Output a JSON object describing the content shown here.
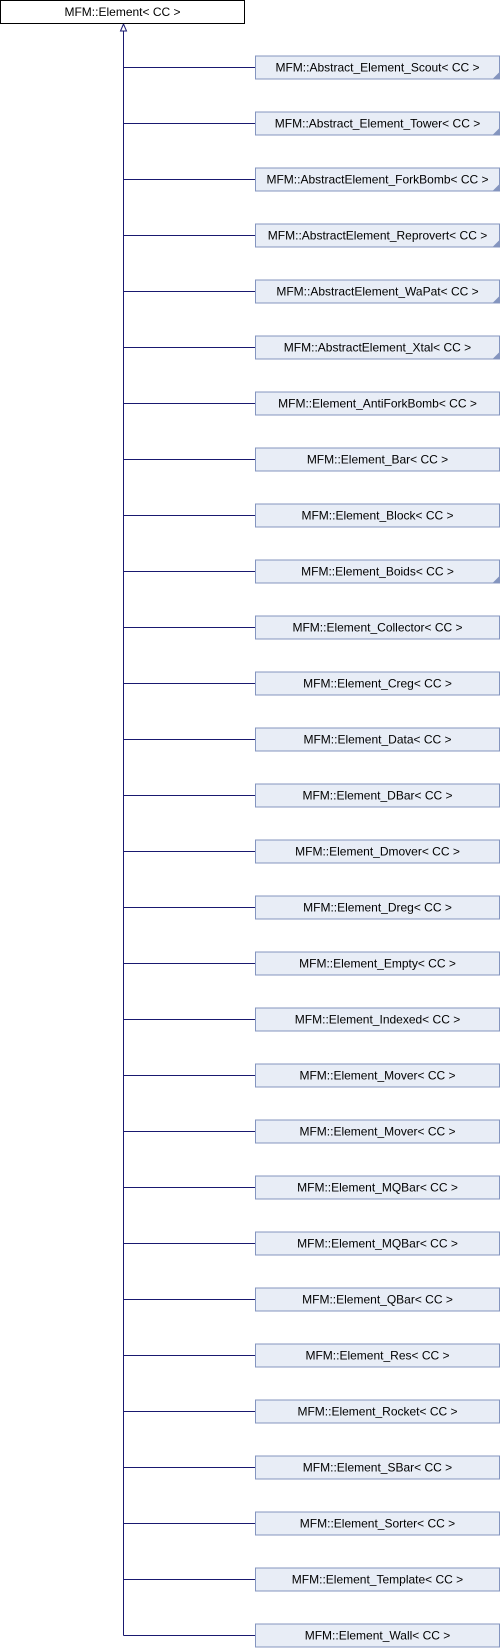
{
  "diagram": {
    "type": "inheritance-diagram",
    "base": {
      "label": "MFM::Element< CC >"
    },
    "derived": [
      {
        "label": "MFM::Abstract_Element_Scout< CC >",
        "has_more": true
      },
      {
        "label": "MFM::Abstract_Element_Tower< CC >",
        "has_more": true
      },
      {
        "label": "MFM::AbstractElement_ForkBomb< CC >",
        "has_more": true
      },
      {
        "label": "MFM::AbstractElement_Reprovert< CC >",
        "has_more": true
      },
      {
        "label": "MFM::AbstractElement_WaPat< CC >",
        "has_more": true
      },
      {
        "label": "MFM::AbstractElement_Xtal< CC >",
        "has_more": true
      },
      {
        "label": "MFM::Element_AntiForkBomb< CC >",
        "has_more": false
      },
      {
        "label": "MFM::Element_Bar< CC >",
        "has_more": false
      },
      {
        "label": "MFM::Element_Block< CC >",
        "has_more": false
      },
      {
        "label": "MFM::Element_Boids< CC >",
        "has_more": true
      },
      {
        "label": "MFM::Element_Collector< CC >",
        "has_more": false
      },
      {
        "label": "MFM::Element_Creg< CC >",
        "has_more": false
      },
      {
        "label": "MFM::Element_Data< CC >",
        "has_more": false
      },
      {
        "label": "MFM::Element_DBar< CC >",
        "has_more": false
      },
      {
        "label": "MFM::Element_Dmover< CC >",
        "has_more": false
      },
      {
        "label": "MFM::Element_Dreg< CC >",
        "has_more": false
      },
      {
        "label": "MFM::Element_Empty< CC >",
        "has_more": false
      },
      {
        "label": "MFM::Element_Indexed< CC >",
        "has_more": false
      },
      {
        "label": "MFM::Element_Mover< CC >",
        "has_more": false
      },
      {
        "label": "MFM::Element_Mover< CC >",
        "has_more": false
      },
      {
        "label": "MFM::Element_MQBar< CC >",
        "has_more": false
      },
      {
        "label": "MFM::Element_MQBar< CC >",
        "has_more": false
      },
      {
        "label": "MFM::Element_QBar< CC >",
        "has_more": false
      },
      {
        "label": "MFM::Element_Res< CC >",
        "has_more": false
      },
      {
        "label": "MFM::Element_Rocket< CC >",
        "has_more": false
      },
      {
        "label": "MFM::Element_SBar< CC >",
        "has_more": false
      },
      {
        "label": "MFM::Element_Sorter< CC >",
        "has_more": false
      },
      {
        "label": "MFM::Element_Template< CC >",
        "has_more": false
      },
      {
        "label": "MFM::Element_Wall< CC >",
        "has_more": false
      }
    ],
    "colors": {
      "base_fill": "#ffffff",
      "base_stroke": "#000000",
      "derived_fill": "#e8edf6",
      "derived_stroke": "#8495bf",
      "edge": "#191970",
      "more_marker": "#8495bf"
    }
  }
}
